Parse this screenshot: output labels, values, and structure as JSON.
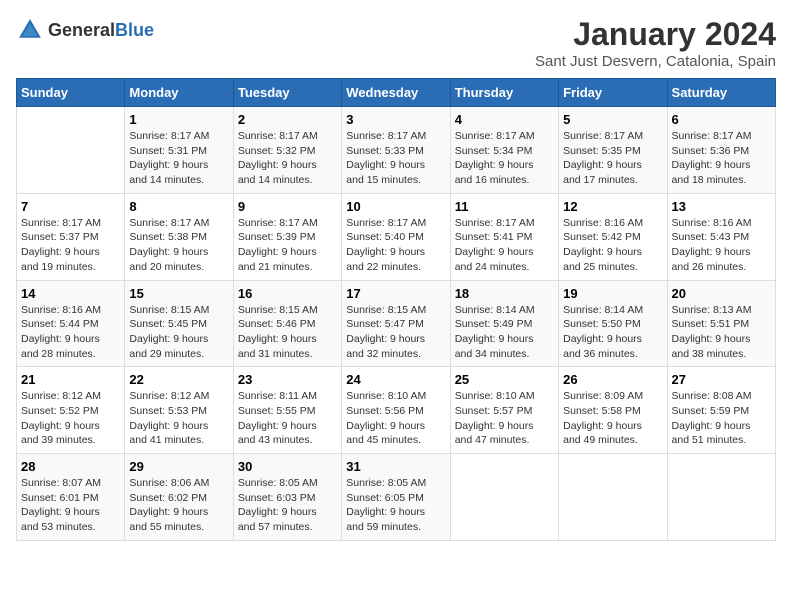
{
  "header": {
    "logo": {
      "text_general": "General",
      "text_blue": "Blue"
    },
    "title": "January 2024",
    "subtitle": "Sant Just Desvern, Catalonia, Spain"
  },
  "calendar": {
    "weekdays": [
      "Sunday",
      "Monday",
      "Tuesday",
      "Wednesday",
      "Thursday",
      "Friday",
      "Saturday"
    ],
    "weeks": [
      [
        {
          "day": "",
          "content": ""
        },
        {
          "day": "1",
          "content": "Sunrise: 8:17 AM\nSunset: 5:31 PM\nDaylight: 9 hours\nand 14 minutes."
        },
        {
          "day": "2",
          "content": "Sunrise: 8:17 AM\nSunset: 5:32 PM\nDaylight: 9 hours\nand 14 minutes."
        },
        {
          "day": "3",
          "content": "Sunrise: 8:17 AM\nSunset: 5:33 PM\nDaylight: 9 hours\nand 15 minutes."
        },
        {
          "day": "4",
          "content": "Sunrise: 8:17 AM\nSunset: 5:34 PM\nDaylight: 9 hours\nand 16 minutes."
        },
        {
          "day": "5",
          "content": "Sunrise: 8:17 AM\nSunset: 5:35 PM\nDaylight: 9 hours\nand 17 minutes."
        },
        {
          "day": "6",
          "content": "Sunrise: 8:17 AM\nSunset: 5:36 PM\nDaylight: 9 hours\nand 18 minutes."
        }
      ],
      [
        {
          "day": "7",
          "content": "Sunrise: 8:17 AM\nSunset: 5:37 PM\nDaylight: 9 hours\nand 19 minutes."
        },
        {
          "day": "8",
          "content": "Sunrise: 8:17 AM\nSunset: 5:38 PM\nDaylight: 9 hours\nand 20 minutes."
        },
        {
          "day": "9",
          "content": "Sunrise: 8:17 AM\nSunset: 5:39 PM\nDaylight: 9 hours\nand 21 minutes."
        },
        {
          "day": "10",
          "content": "Sunrise: 8:17 AM\nSunset: 5:40 PM\nDaylight: 9 hours\nand 22 minutes."
        },
        {
          "day": "11",
          "content": "Sunrise: 8:17 AM\nSunset: 5:41 PM\nDaylight: 9 hours\nand 24 minutes."
        },
        {
          "day": "12",
          "content": "Sunrise: 8:16 AM\nSunset: 5:42 PM\nDaylight: 9 hours\nand 25 minutes."
        },
        {
          "day": "13",
          "content": "Sunrise: 8:16 AM\nSunset: 5:43 PM\nDaylight: 9 hours\nand 26 minutes."
        }
      ],
      [
        {
          "day": "14",
          "content": "Sunrise: 8:16 AM\nSunset: 5:44 PM\nDaylight: 9 hours\nand 28 minutes."
        },
        {
          "day": "15",
          "content": "Sunrise: 8:15 AM\nSunset: 5:45 PM\nDaylight: 9 hours\nand 29 minutes."
        },
        {
          "day": "16",
          "content": "Sunrise: 8:15 AM\nSunset: 5:46 PM\nDaylight: 9 hours\nand 31 minutes."
        },
        {
          "day": "17",
          "content": "Sunrise: 8:15 AM\nSunset: 5:47 PM\nDaylight: 9 hours\nand 32 minutes."
        },
        {
          "day": "18",
          "content": "Sunrise: 8:14 AM\nSunset: 5:49 PM\nDaylight: 9 hours\nand 34 minutes."
        },
        {
          "day": "19",
          "content": "Sunrise: 8:14 AM\nSunset: 5:50 PM\nDaylight: 9 hours\nand 36 minutes."
        },
        {
          "day": "20",
          "content": "Sunrise: 8:13 AM\nSunset: 5:51 PM\nDaylight: 9 hours\nand 38 minutes."
        }
      ],
      [
        {
          "day": "21",
          "content": "Sunrise: 8:12 AM\nSunset: 5:52 PM\nDaylight: 9 hours\nand 39 minutes."
        },
        {
          "day": "22",
          "content": "Sunrise: 8:12 AM\nSunset: 5:53 PM\nDaylight: 9 hours\nand 41 minutes."
        },
        {
          "day": "23",
          "content": "Sunrise: 8:11 AM\nSunset: 5:55 PM\nDaylight: 9 hours\nand 43 minutes."
        },
        {
          "day": "24",
          "content": "Sunrise: 8:10 AM\nSunset: 5:56 PM\nDaylight: 9 hours\nand 45 minutes."
        },
        {
          "day": "25",
          "content": "Sunrise: 8:10 AM\nSunset: 5:57 PM\nDaylight: 9 hours\nand 47 minutes."
        },
        {
          "day": "26",
          "content": "Sunrise: 8:09 AM\nSunset: 5:58 PM\nDaylight: 9 hours\nand 49 minutes."
        },
        {
          "day": "27",
          "content": "Sunrise: 8:08 AM\nSunset: 5:59 PM\nDaylight: 9 hours\nand 51 minutes."
        }
      ],
      [
        {
          "day": "28",
          "content": "Sunrise: 8:07 AM\nSunset: 6:01 PM\nDaylight: 9 hours\nand 53 minutes."
        },
        {
          "day": "29",
          "content": "Sunrise: 8:06 AM\nSunset: 6:02 PM\nDaylight: 9 hours\nand 55 minutes."
        },
        {
          "day": "30",
          "content": "Sunrise: 8:05 AM\nSunset: 6:03 PM\nDaylight: 9 hours\nand 57 minutes."
        },
        {
          "day": "31",
          "content": "Sunrise: 8:05 AM\nSunset: 6:05 PM\nDaylight: 9 hours\nand 59 minutes."
        },
        {
          "day": "",
          "content": ""
        },
        {
          "day": "",
          "content": ""
        },
        {
          "day": "",
          "content": ""
        }
      ]
    ]
  }
}
